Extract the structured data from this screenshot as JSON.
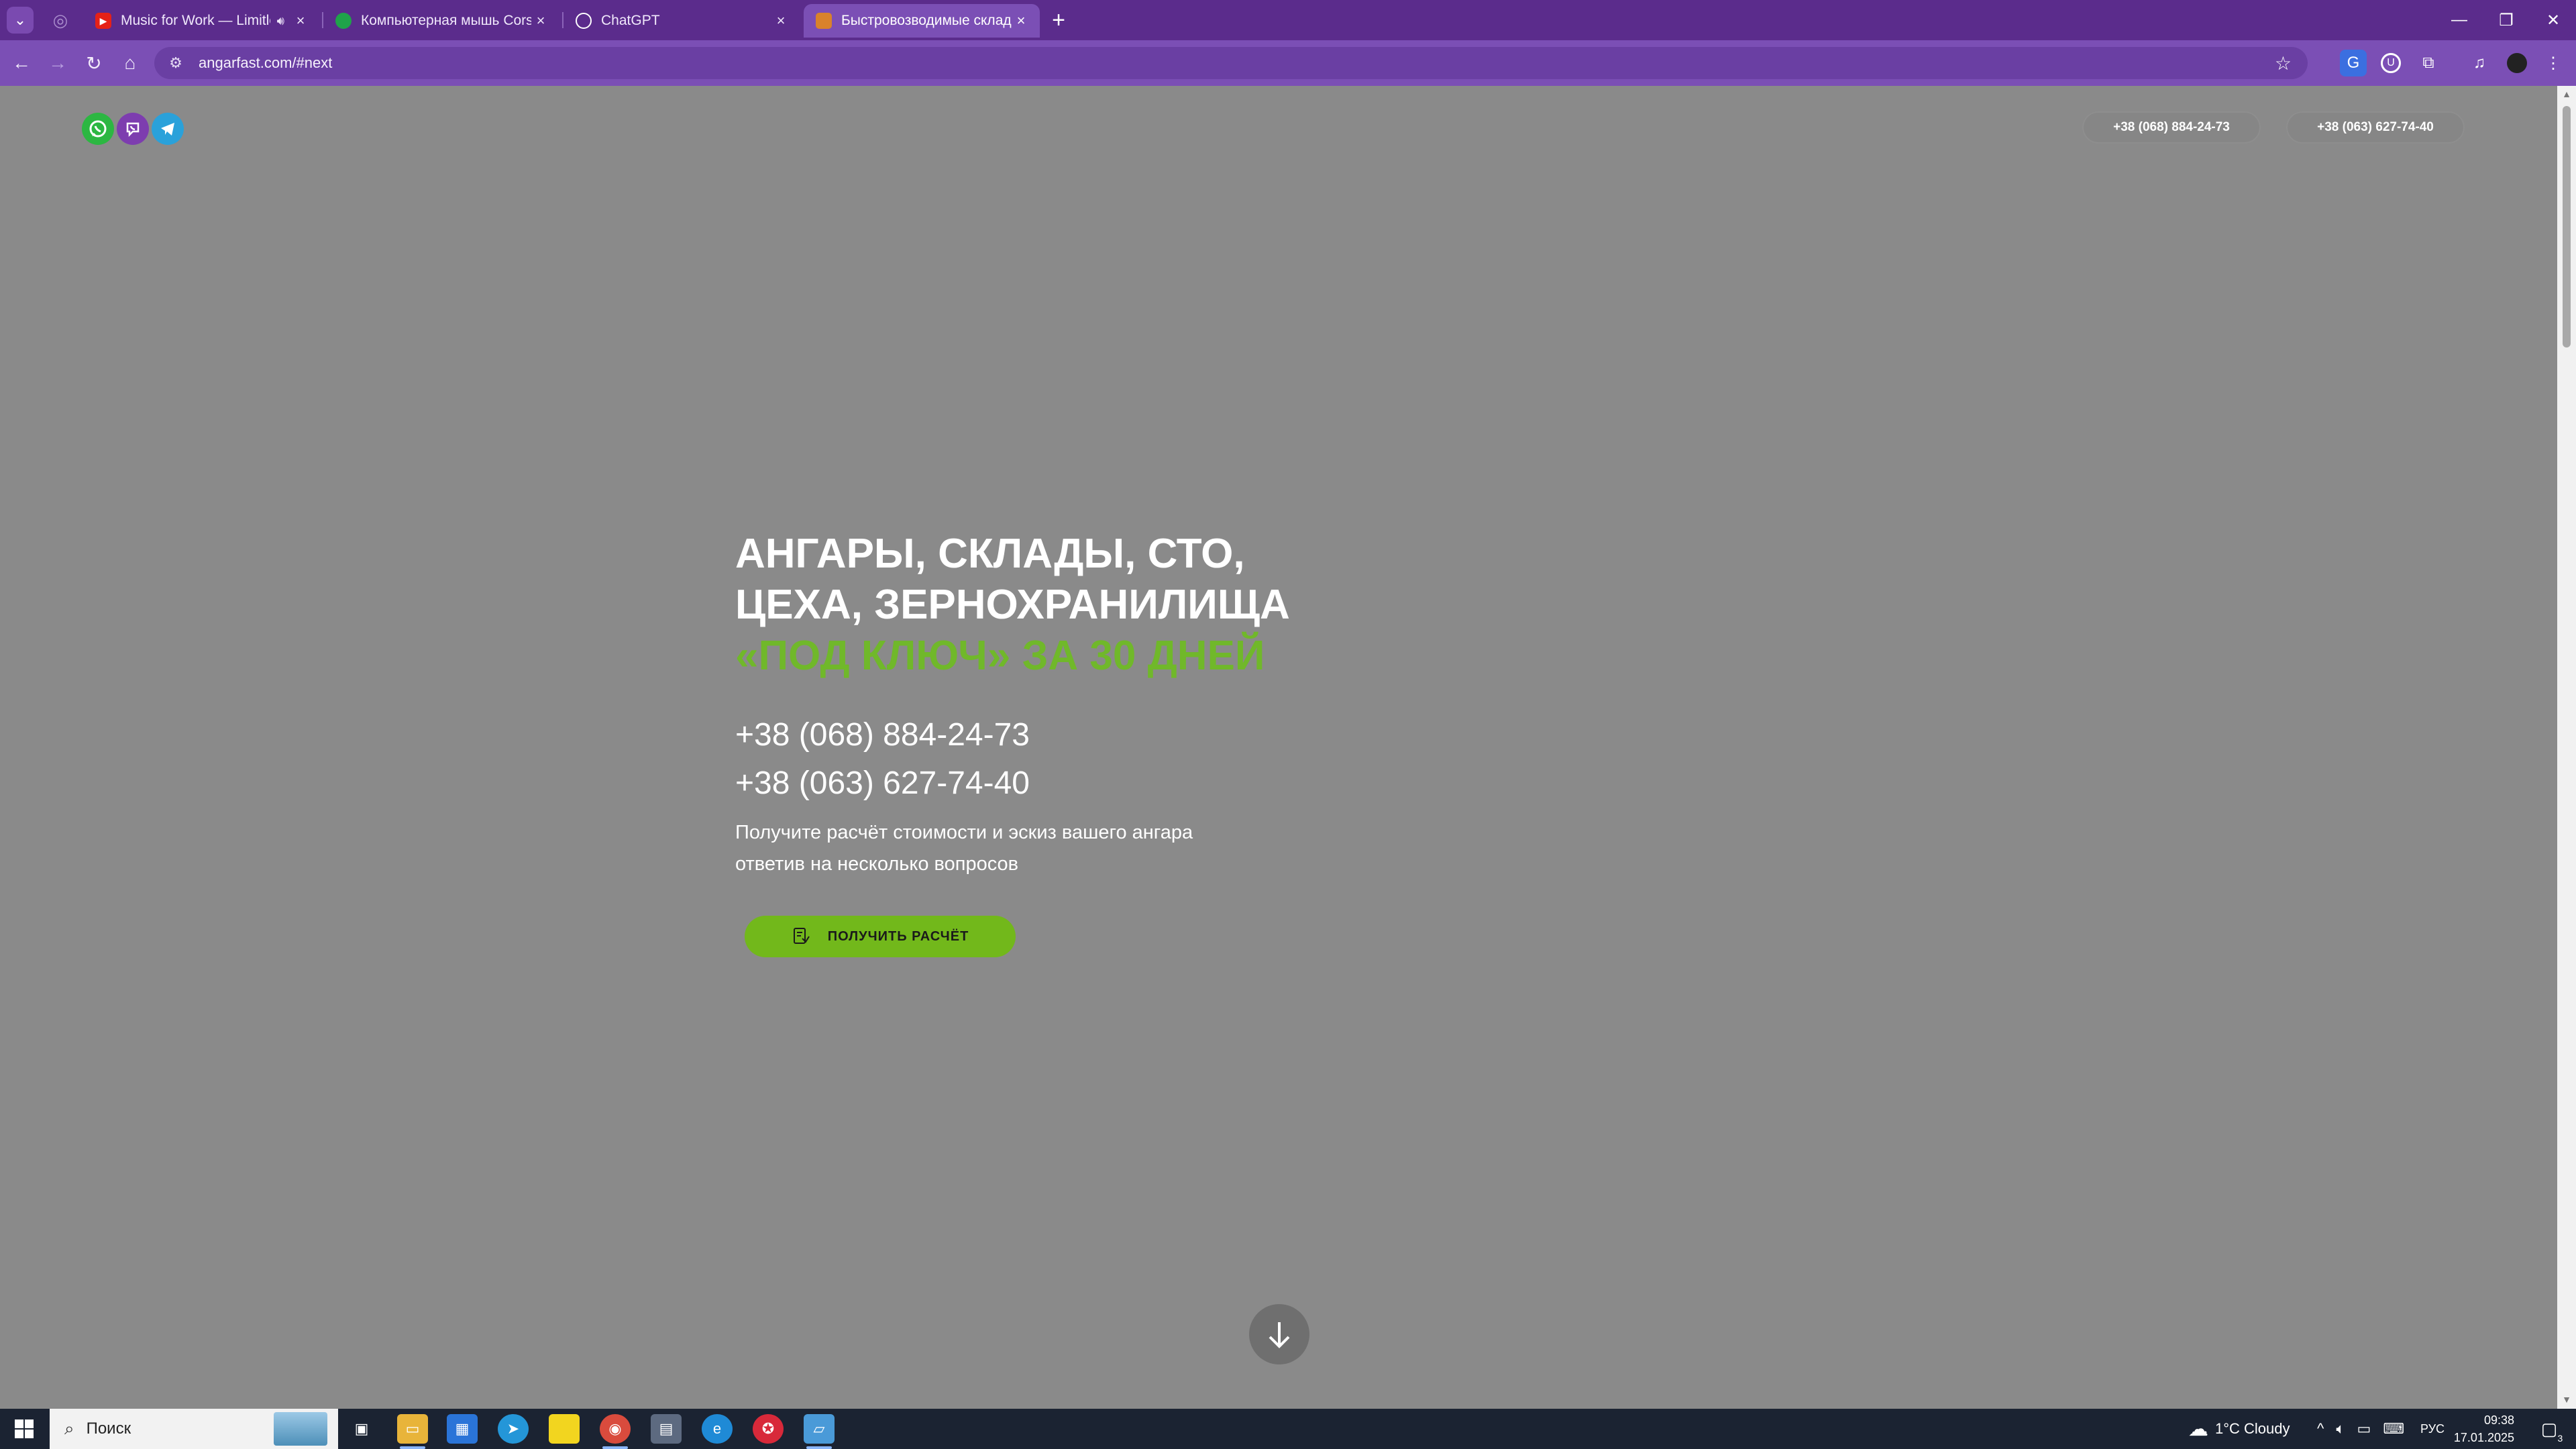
{
  "browser": {
    "tabs": [
      {
        "title": "Music for Work — Limitless",
        "favicon": "youtube-icon",
        "audio": true,
        "active": false
      },
      {
        "title": "Компьютерная мышь Corsair",
        "favicon": "site-icon",
        "audio": false,
        "active": false
      },
      {
        "title": "ChatGPT",
        "favicon": "chatgpt-icon",
        "audio": false,
        "active": false
      },
      {
        "title": "Быстровозводимые склады и",
        "favicon": "site-icon",
        "audio": false,
        "active": true
      }
    ],
    "url": "angarfast.com/#next",
    "accent": "#7b4fb5"
  },
  "header": {
    "phone1": "+38 (068) 884-24-73",
    "phone2": "+38 (063) 627-74-40"
  },
  "hero": {
    "title_line1": "АНГАРЫ, СКЛАДЫ, СТО,",
    "title_line2": "ЦЕХА, ЗЕРНОХРАНИЛИЩА",
    "title_line3": "«ПОД КЛЮЧ» ЗА 30 ДНЕЙ",
    "phone1": "+38 (068) 884-24-73",
    "phone2": "+38 (063) 627-74-40",
    "text_line1": "Получите расчёт стоимости и эскиз вашего ангара",
    "text_line2": "ответив на несколько вопросов",
    "cta_label": "ПОЛУЧИТЬ РАСЧЁТ",
    "accent": "#70b82a"
  },
  "taskbar": {
    "search_placeholder": "Поиск",
    "weather": "1°C  Cloudy",
    "language": "РУС",
    "time": "09:38",
    "date": "17.01.2025",
    "notifications": "3"
  }
}
